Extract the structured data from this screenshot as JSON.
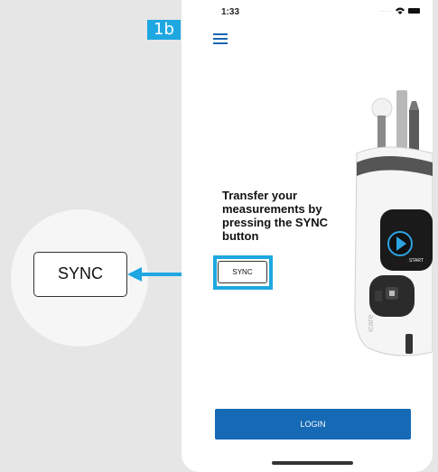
{
  "step_label": "1b",
  "status_bar": {
    "time": "1:33",
    "dots": "....."
  },
  "heading": "Transfer your measurements by pressing the SYNC button",
  "sync_button_label": "SYNC",
  "zoomed_sync_label": "SYNC",
  "login_button_label": "LOGIN",
  "device": {
    "brand_text": "icare",
    "screen_label": "START"
  },
  "colors": {
    "accent": "#1ea7e1",
    "primary": "#1669b5",
    "background": "#e6e6e6"
  },
  "icons": [
    "menu-icon",
    "wifi-icon",
    "battery-icon",
    "arrow-left-icon",
    "play-icon"
  ]
}
